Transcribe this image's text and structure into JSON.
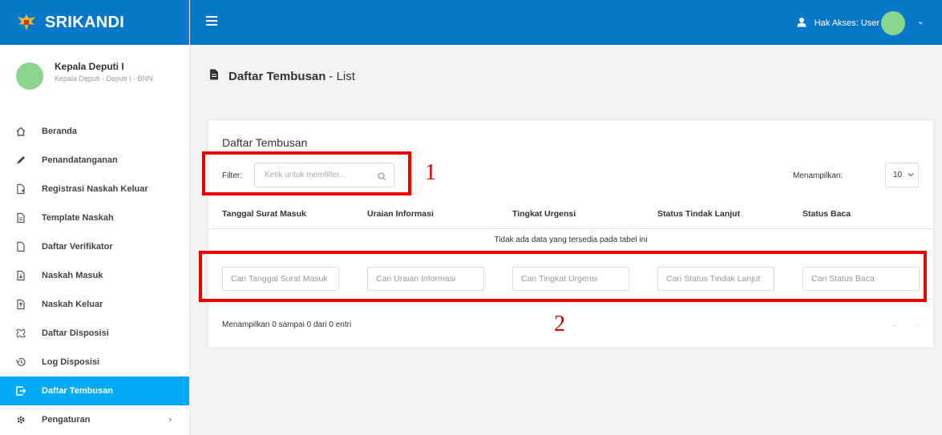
{
  "brand": {
    "name": "SRIKANDI"
  },
  "profile": {
    "name": "Kepala Deputi I",
    "role": "Kepala Deputi - Deputi I - BNN"
  },
  "sidebar": {
    "items": [
      {
        "label": "Beranda",
        "icon": "home-icon"
      },
      {
        "label": "Penandatanganan",
        "icon": "pen-icon"
      },
      {
        "label": "Registrasi Naskah Keluar",
        "icon": "file-plus-icon"
      },
      {
        "label": "Template Naskah",
        "icon": "file-text-icon"
      },
      {
        "label": "Daftar Verifikator",
        "icon": "file-icon"
      },
      {
        "label": "Naskah Masuk",
        "icon": "file-download-icon"
      },
      {
        "label": "Naskah Keluar",
        "icon": "file-upload-icon"
      },
      {
        "label": "Daftar Disposisi",
        "icon": "disposition-icon"
      },
      {
        "label": "Log Disposisi",
        "icon": "history-icon"
      },
      {
        "label": "Daftar Tembusan",
        "icon": "export-icon",
        "active": true
      },
      {
        "label": "Pengaturan",
        "icon": "gear-icon",
        "chevron": "›"
      }
    ]
  },
  "topbar": {
    "access_label": "Hak Akses: User",
    "chevron": "⌄"
  },
  "page": {
    "title_bold": "Daftar Tembusan",
    "title_rest": "- List"
  },
  "card": {
    "title": "Daftar Tembusan",
    "filter_label": "Filter:",
    "filter_placeholder": "Ketik untuk memfilter...",
    "show_label": "Menampilkan:",
    "show_value": "10",
    "columns": [
      "Tanggal Surat Masuk",
      "Uraian Informasi",
      "Tingkat Urgensi",
      "Status Tindak Lanjut",
      "Status Baca"
    ],
    "empty_message": "Tidak ada data yang tersedia pada tabel ini",
    "column_search_placeholders": [
      "Cari Tanggal Surat Masuk",
      "Cari Uraian Informasi",
      "Cari Tingkat Urgensi",
      "Cari Status Tindak Lanjut",
      "Cari Status Baca"
    ],
    "info": "Menampilkan 0 sampai 0 dari 0 entri",
    "pager_prev": "←",
    "pager_next": "→"
  },
  "annotations": {
    "label_1": "1",
    "label_2": "2"
  },
  "colors": {
    "header_blue": "#0a78c8",
    "active_item": "#03a9f4",
    "annotation_red": "#ee0000"
  }
}
